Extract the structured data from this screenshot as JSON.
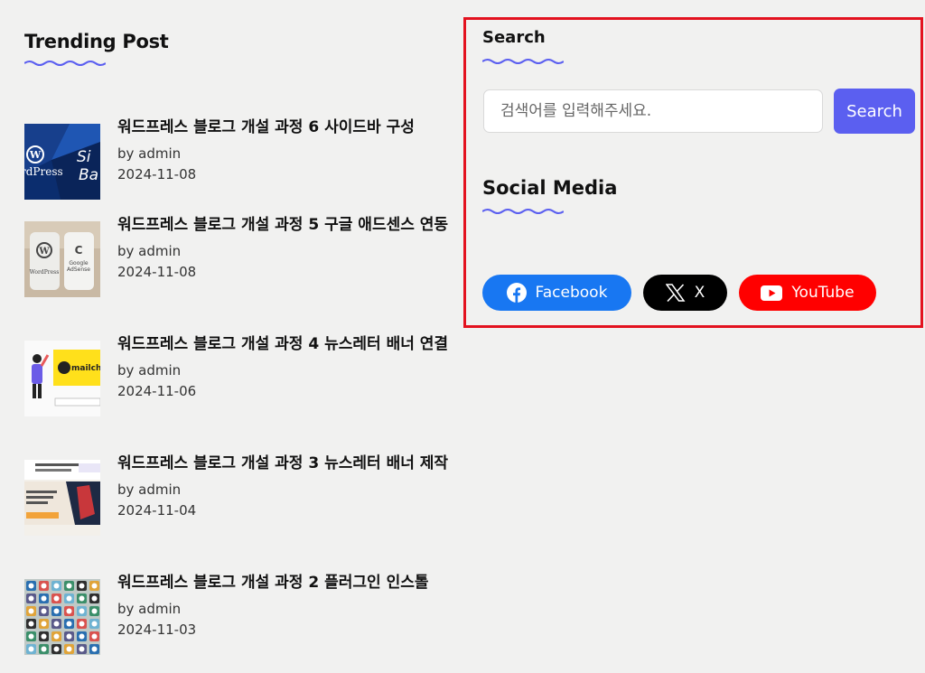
{
  "trending": {
    "title": "Trending Post",
    "posts": [
      {
        "title": "워드프레스 블로그 개설 과정 6 사이드바 구성",
        "author": "by admin",
        "date": "2024-11-08",
        "thumb_icon": "wordpress-sidebar-thumbnail"
      },
      {
        "title": "워드프레스 블로그 개설 과정 5 구글 애드센스 연동",
        "author": "by admin",
        "date": "2024-11-08",
        "thumb_icon": "wordpress-adsense-thumbnail"
      },
      {
        "title": "워드프레스 블로그 개설 과정 4 뉴스레터 배너 연결",
        "author": "by admin",
        "date": "2024-11-06",
        "thumb_icon": "mailchimp-thumbnail"
      },
      {
        "title": "워드프레스 블로그 개설 과정 3 뉴스레터 배너 제작",
        "author": "by admin",
        "date": "2024-11-04",
        "thumb_icon": "newsletter-banner-thumbnail"
      },
      {
        "title": "워드프레스 블로그 개설 과정 2 플러그인 인스톨",
        "author": "by admin",
        "date": "2024-11-03",
        "thumb_icon": "plugin-icons-thumbnail"
      }
    ]
  },
  "sidebar": {
    "search_title": "Search",
    "search_placeholder": "검색어를 입력해주세요.",
    "search_button": "Search",
    "social_title": "Social Media",
    "social": [
      {
        "label": "Facebook",
        "icon": "facebook-icon",
        "color": "#1877f2"
      },
      {
        "label": "X",
        "icon": "x-icon",
        "color": "#000000"
      },
      {
        "label": "YouTube",
        "icon": "youtube-icon",
        "color": "#ff0000"
      }
    ]
  },
  "colors": {
    "accent": "#5b5ff0",
    "highlight_border": "#e3121f",
    "background": "#f1f1f0"
  }
}
